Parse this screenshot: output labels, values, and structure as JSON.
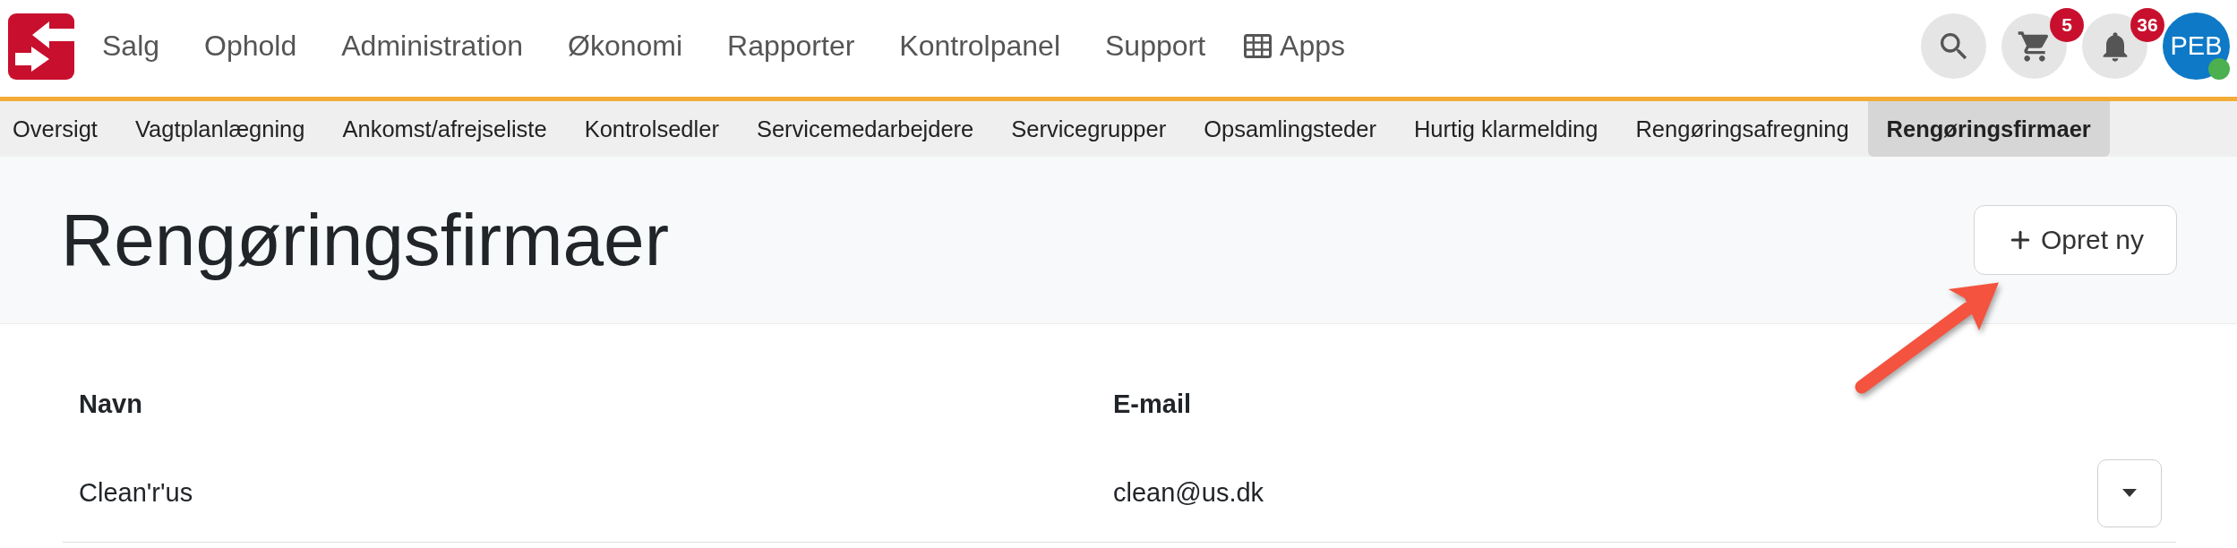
{
  "main_nav": {
    "items": [
      "Salg",
      "Ophold",
      "Administration",
      "Økonomi",
      "Rapporter",
      "Kontrolpanel",
      "Support"
    ],
    "apps": {
      "label": "Apps"
    }
  },
  "actions": {
    "cart_count": "5",
    "notification_count": "36"
  },
  "user": {
    "initials": "PEB",
    "online": true
  },
  "sub_nav": {
    "items": [
      {
        "label": "Oversigt",
        "selected": false
      },
      {
        "label": "Vagtplanlægning",
        "selected": false
      },
      {
        "label": "Ankomst/afrejseliste",
        "selected": false
      },
      {
        "label": "Kontrolsedler",
        "selected": false
      },
      {
        "label": "Servicemedarbejdere",
        "selected": false
      },
      {
        "label": "Servicegrupper",
        "selected": false
      },
      {
        "label": "Opsamlingsteder",
        "selected": false
      },
      {
        "label": "Hurtig klarmelding",
        "selected": false
      },
      {
        "label": "Rengøringsafregning",
        "selected": false
      },
      {
        "label": "Rengøringsfirmaer",
        "selected": true
      }
    ]
  },
  "page_header": {
    "title": "Rengøringsfirmaer",
    "create_button": {
      "label": "Opret ny"
    }
  },
  "table": {
    "columns": [
      "Navn",
      "E-mail"
    ],
    "rows": [
      {
        "cells": [
          "Clean'r'us",
          "clean@us.dk"
        ]
      }
    ]
  }
}
